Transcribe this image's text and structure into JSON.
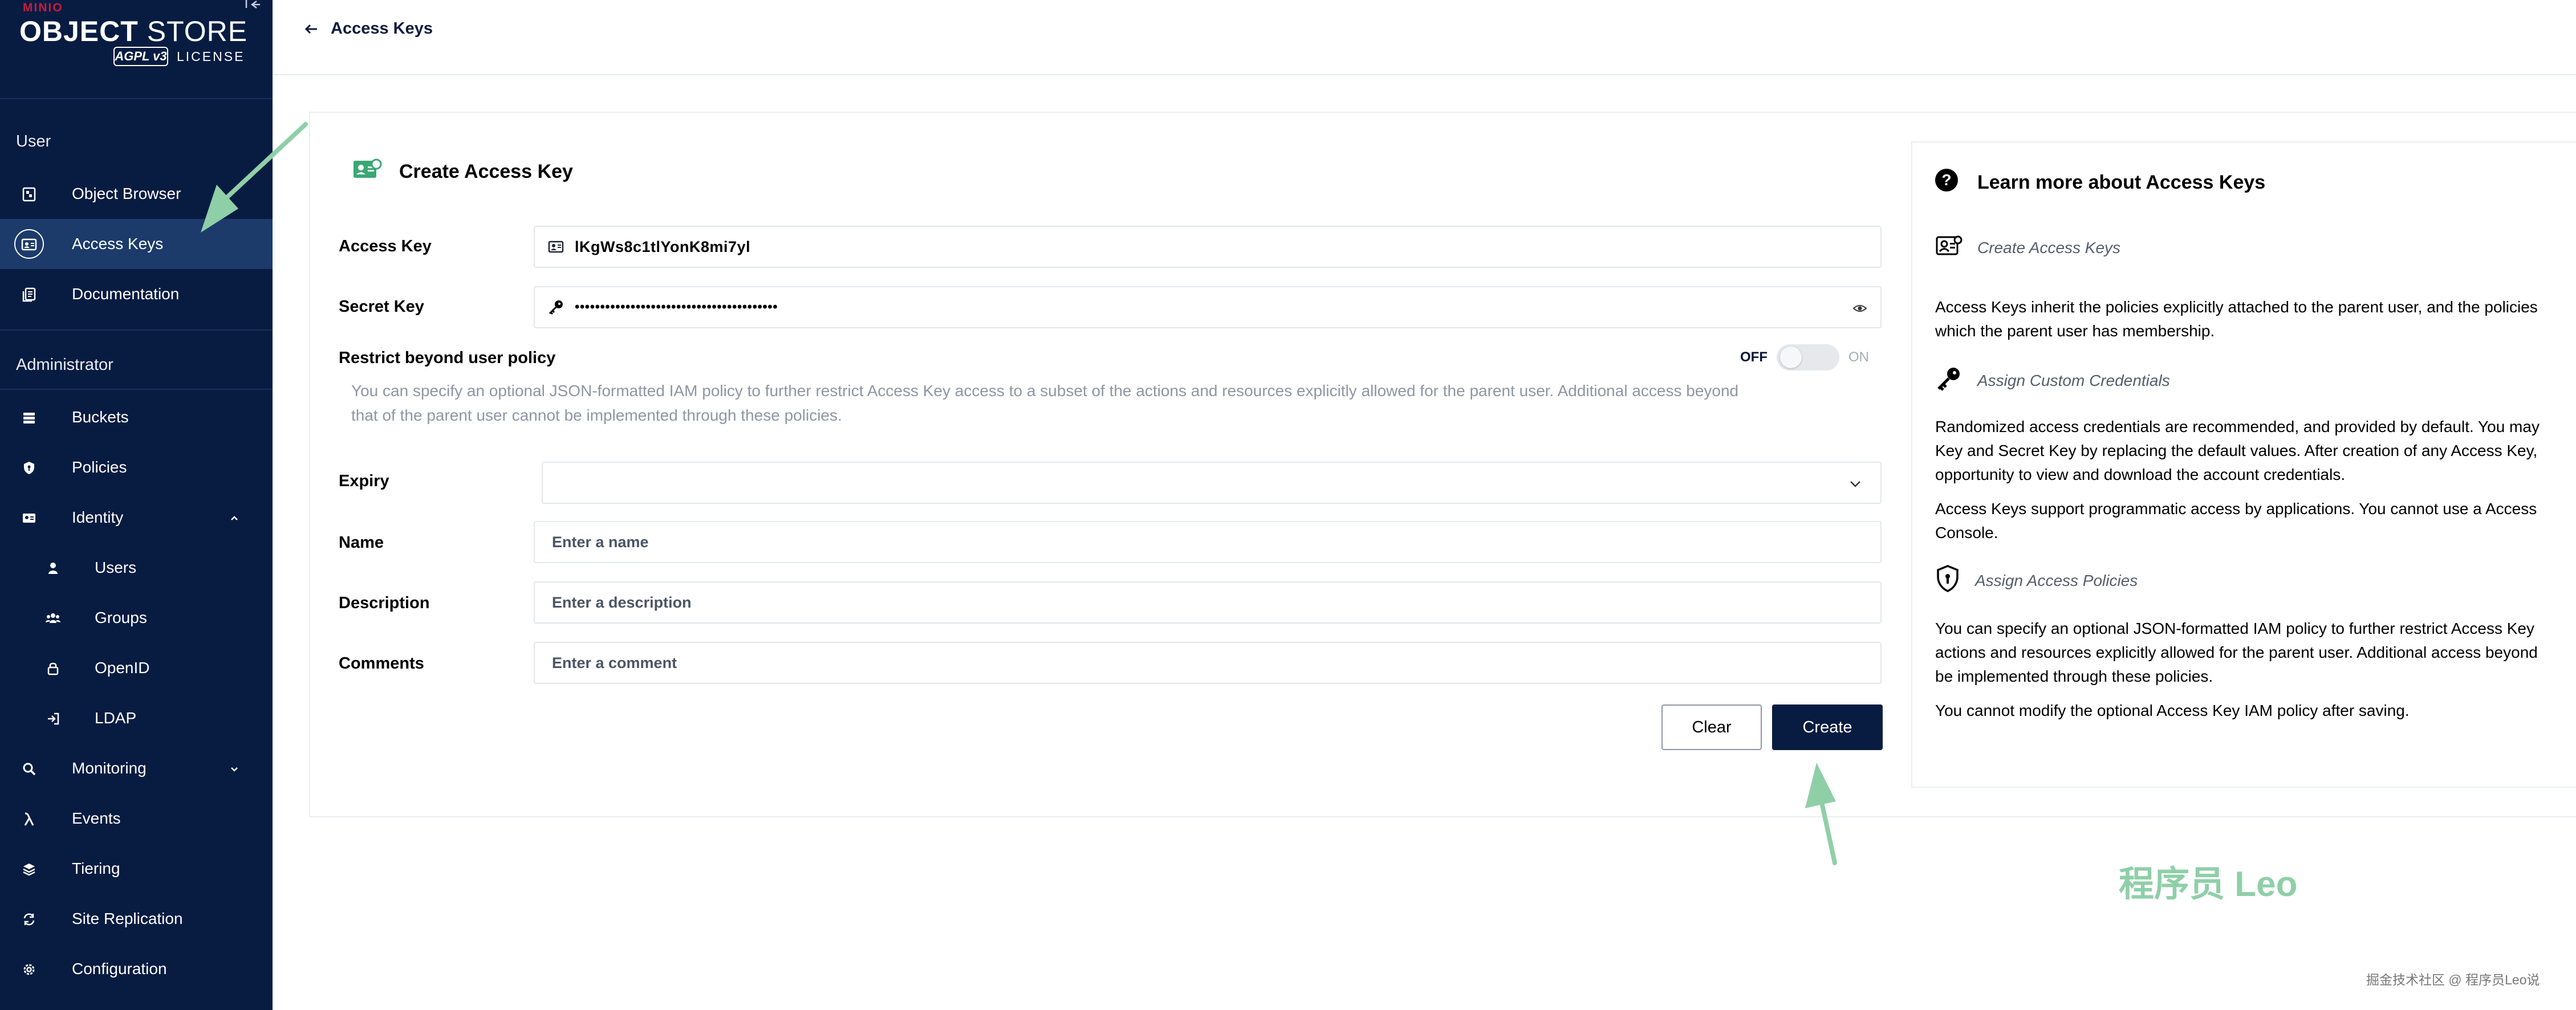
{
  "sidebar": {
    "logo": {
      "brand": "MINIO",
      "product_bold": "OBJECT",
      "product": "STORE",
      "badge": "AGPL v3",
      "license": "LICENSE"
    },
    "sections": {
      "user": "User",
      "admin": "Administrator"
    },
    "items": {
      "object_browser": "Object Browser",
      "access_keys": "Access Keys",
      "documentation": "Documentation",
      "buckets": "Buckets",
      "policies": "Policies",
      "identity": "Identity",
      "users": "Users",
      "groups": "Groups",
      "openid": "OpenID",
      "ldap": "LDAP",
      "monitoring": "Monitoring",
      "events": "Events",
      "tiering": "Tiering",
      "site_replication": "Site Replication",
      "configuration": "Configuration"
    },
    "active_item": "access_keys"
  },
  "topbar": {
    "back_label": "Access Keys"
  },
  "form": {
    "title": "Create Access Key",
    "access_key": {
      "label": "Access Key",
      "value": "lKgWs8c1tlYonK8mi7yl"
    },
    "secret_key": {
      "label": "Secret Key",
      "value": "••••••••••••••••••••••••••••••••••••••••"
    },
    "restrict": {
      "label": "Restrict beyond user policy",
      "description_line1": "You can specify an optional JSON-formatted IAM policy to further restrict Access Key access to a subset of the actions and resources explicitly allowed for the parent user. Additional access beyond",
      "description_line2": "that of the parent user cannot be implemented through these policies.",
      "toggle_off": "OFF",
      "toggle_on": "ON",
      "enabled": false
    },
    "expiry": {
      "label": "Expiry",
      "value": ""
    },
    "name": {
      "label": "Name",
      "placeholder": "Enter a name"
    },
    "description": {
      "label": "Description",
      "placeholder": "Enter a description"
    },
    "comments": {
      "label": "Comments",
      "placeholder": "Enter a comment"
    },
    "buttons": {
      "clear": "Clear",
      "create": "Create"
    }
  },
  "help": {
    "title": "Learn more about Access Keys",
    "sections": [
      {
        "heading": "Create Access Keys",
        "icon": "access-key-card-icon",
        "paragraphs": [
          [
            "Access Keys inherit the policies explicitly attached to the parent user, and the policies",
            "which the parent user has membership."
          ]
        ]
      },
      {
        "heading": "Assign Custom Credentials",
        "icon": "key-icon",
        "paragraphs": [
          [
            "Randomized access credentials are recommended, and provided by default. You may",
            "Key and Secret Key by replacing the default values. After creation of any Access Key,",
            "opportunity to view and download the account credentials."
          ],
          [
            "Access Keys support programmatic access by applications. You cannot use a Access",
            "Console."
          ]
        ]
      },
      {
        "heading": "Assign Access Policies",
        "icon": "shield-icon",
        "paragraphs": [
          [
            "You can specify an optional JSON-formatted IAM policy to further restrict Access Key",
            "actions and resources explicitly allowed for the parent user. Additional access beyond",
            "be implemented through these policies."
          ],
          [
            "You cannot modify the optional Access Key IAM policy after saving."
          ]
        ]
      }
    ]
  },
  "watermark": "程序员 Leo",
  "footer_note": "掘金技术社区 @ 程序员Leo说",
  "colors": {
    "sidebar_bg": "#081c42",
    "sidebar_active": "#1c3b6b",
    "primary_button": "#081c42",
    "annotation_arrow": "#8fcfa8",
    "brand_red": "#c51c3f"
  }
}
